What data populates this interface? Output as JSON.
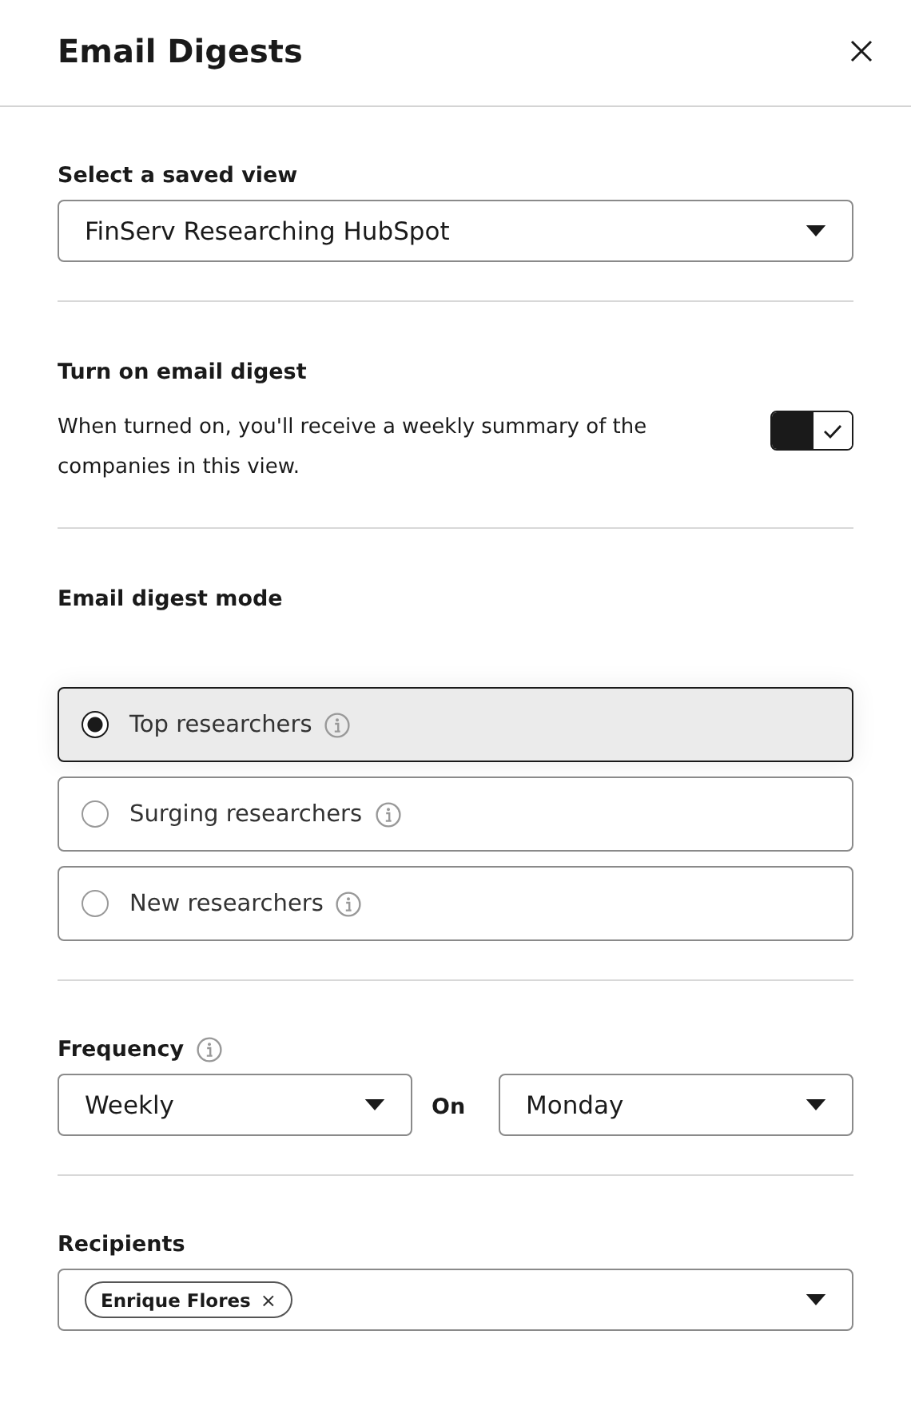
{
  "dialog": {
    "title": "Email Digests"
  },
  "saved_view": {
    "label": "Select a saved view",
    "value": "FinServ Researching HubSpot"
  },
  "digest_toggle": {
    "label": "Turn on email digest",
    "description": "When turned on, you'll receive a weekly summary of the companies in this view.",
    "on": true
  },
  "mode": {
    "label": "Email digest mode",
    "options": [
      {
        "label": "Top researchers",
        "selected": true
      },
      {
        "label": "Surging researchers",
        "selected": false
      },
      {
        "label": "New researchers",
        "selected": false
      }
    ]
  },
  "frequency": {
    "label": "Frequency",
    "value": "Weekly",
    "on_label": "On",
    "day": "Monday"
  },
  "recipients": {
    "label": "Recipients",
    "chips": [
      {
        "label": "Enrique Flores",
        "remove": "×"
      }
    ]
  }
}
